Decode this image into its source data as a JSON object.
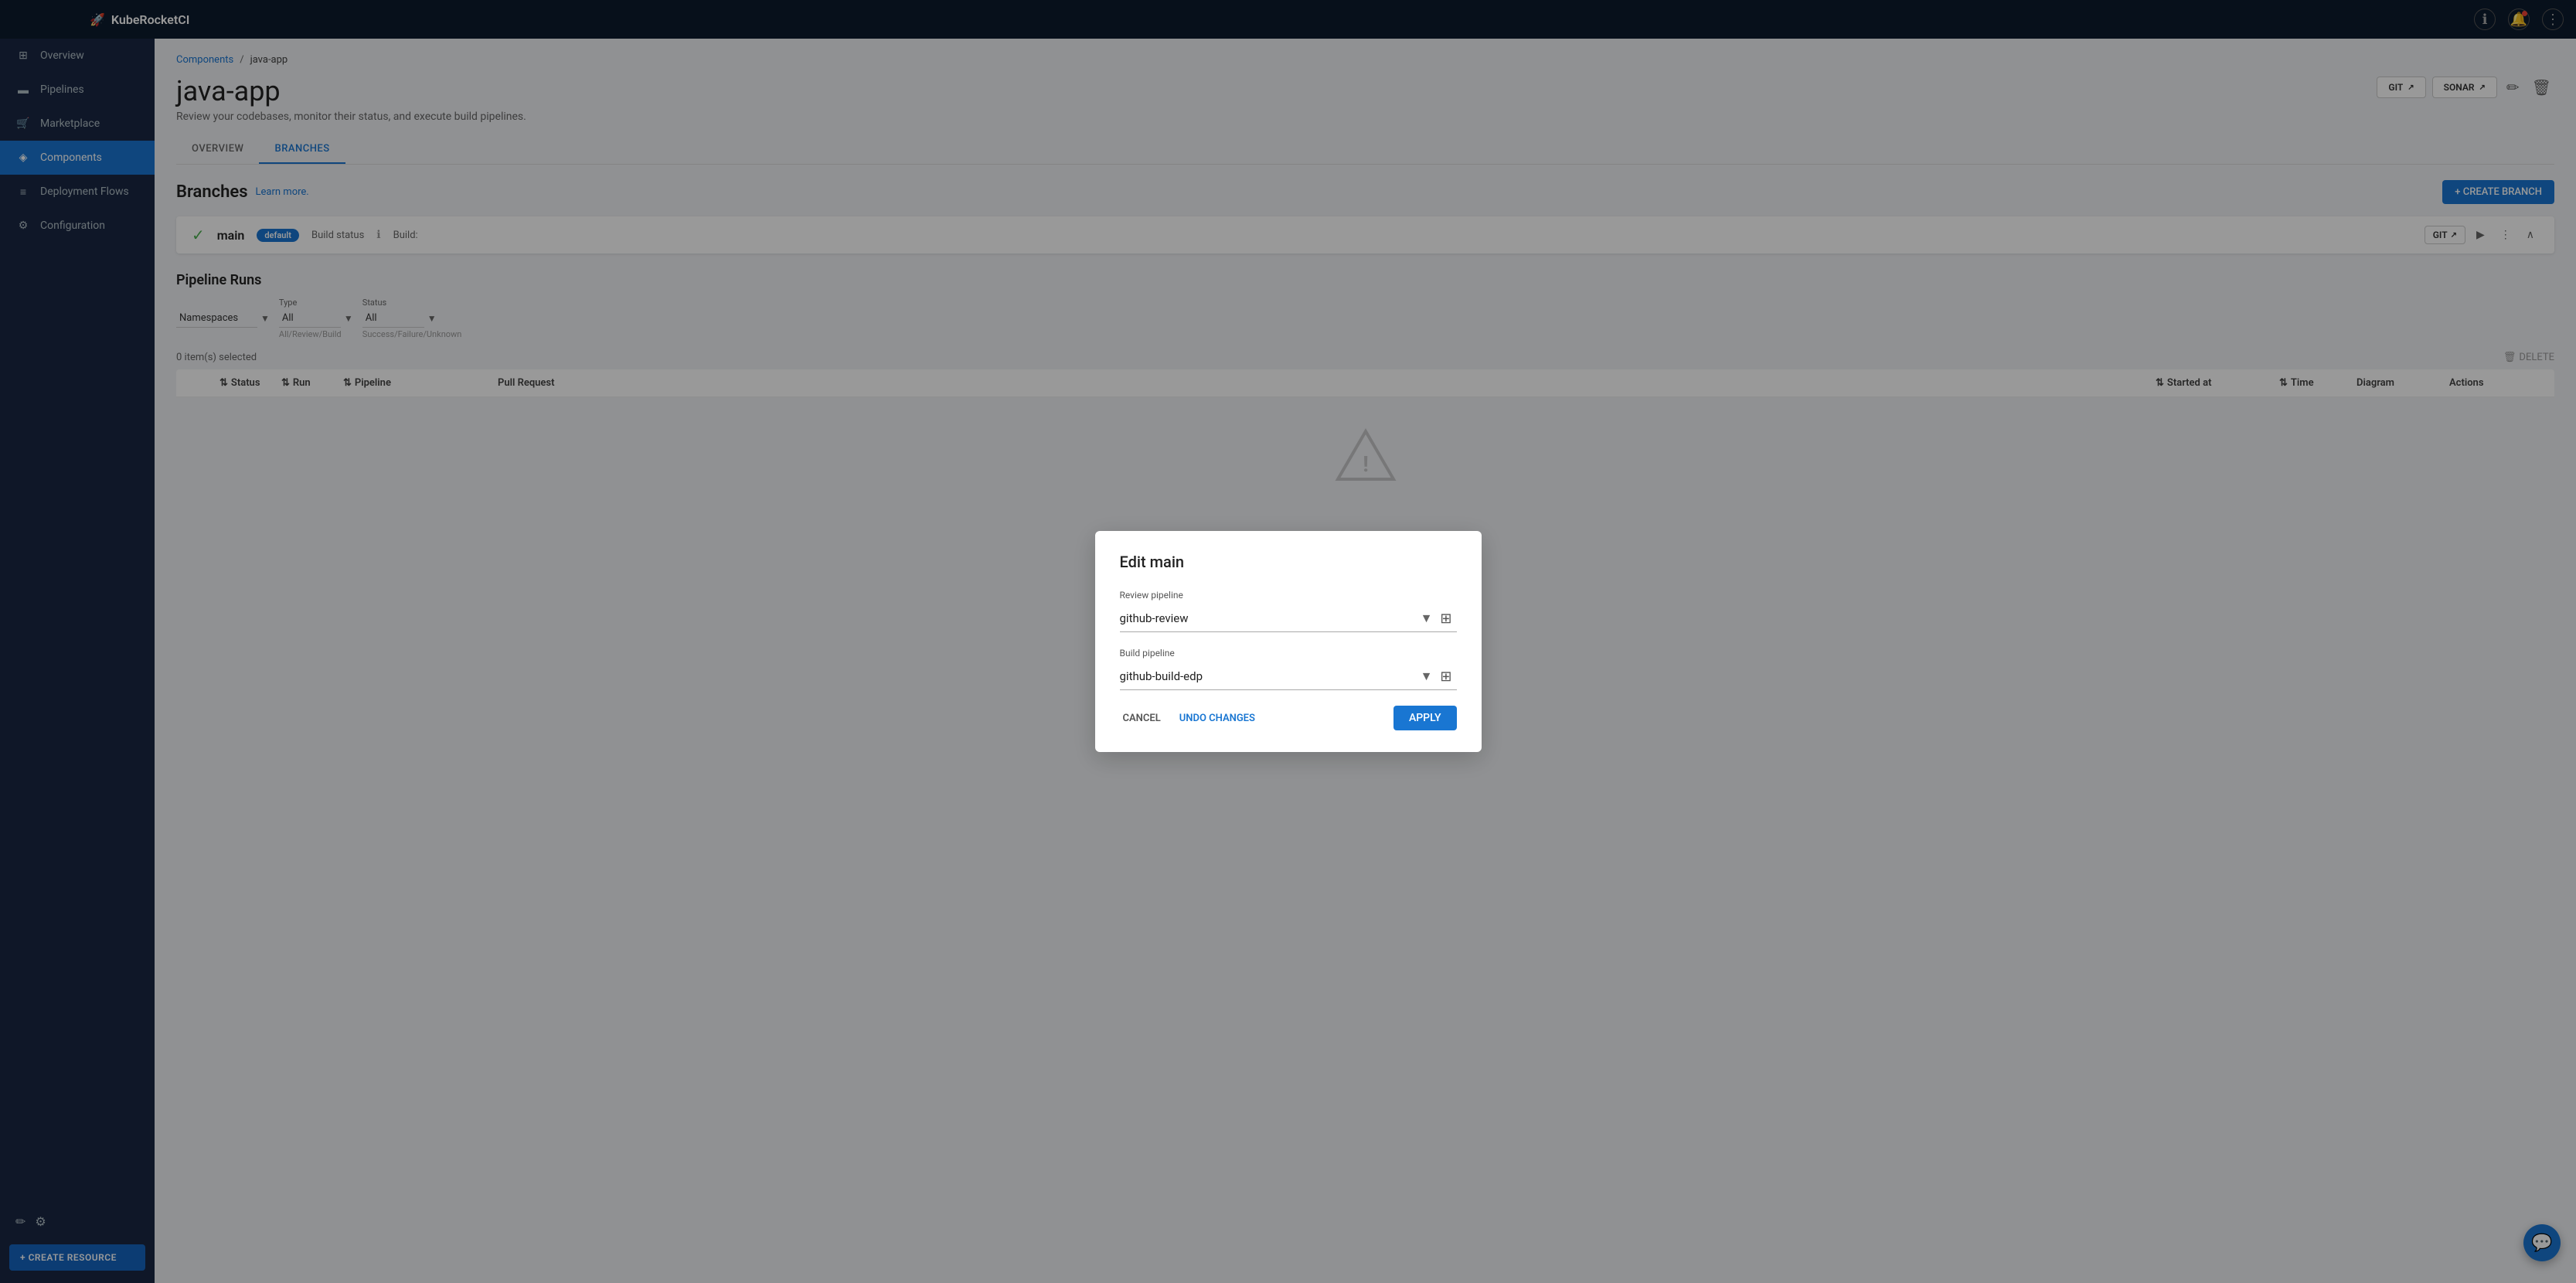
{
  "topbar": {
    "app_name": "KubeRocketCI",
    "logo": "🚀"
  },
  "sidebar": {
    "items": [
      {
        "id": "overview",
        "label": "Overview",
        "icon": "⊞"
      },
      {
        "id": "pipelines",
        "label": "Pipelines",
        "icon": "▬"
      },
      {
        "id": "marketplace",
        "label": "Marketplace",
        "icon": "🛒"
      },
      {
        "id": "components",
        "label": "Components",
        "icon": "◈",
        "active": true
      },
      {
        "id": "deployment-flows",
        "label": "Deployment Flows",
        "icon": "≡"
      },
      {
        "id": "configuration",
        "label": "Configuration",
        "icon": "⚙"
      }
    ],
    "create_resource_label": "+ CREATE RESOURCE"
  },
  "breadcrumb": {
    "parent": "Components",
    "separator": "/",
    "current": "java-app"
  },
  "page": {
    "title": "java-app",
    "subtitle": "Review your codebases, monitor their status, and execute build pipelines.",
    "git_label": "GIT",
    "sonar_label": "SONAR"
  },
  "tabs": [
    {
      "id": "overview",
      "label": "OVERVIEW"
    },
    {
      "id": "branches",
      "label": "BRANCHES",
      "active": true
    }
  ],
  "branches": {
    "title": "Branches",
    "learn_more": "Learn more.",
    "create_branch_label": "+ CREATE BRANCH",
    "items": [
      {
        "name": "main",
        "badge": "default",
        "build_status_label": "Build status",
        "build_label": "Build:"
      }
    ]
  },
  "pipeline_runs": {
    "title": "Pipeline Runs",
    "namespaces_label": "Namespaces",
    "type_label": "Type",
    "type_value": "All",
    "type_hint": "All/Review/Build",
    "status_label": "Status",
    "status_value": "All",
    "status_hint": "Success/Failure/Unknown",
    "selected_count": "0 item(s) selected",
    "delete_label": "DELETE",
    "columns": {
      "status": "Status",
      "run": "Run",
      "pipeline": "Pipeline",
      "pull_request": "Pull Request",
      "started_at": "Started at",
      "time": "Time",
      "diagram": "Diagram",
      "actions": "Actions"
    }
  },
  "modal": {
    "title": "Edit main",
    "review_pipeline_label": "Review pipeline",
    "review_pipeline_value": "github-review",
    "build_pipeline_label": "Build pipeline",
    "build_pipeline_value": "github-build-edp",
    "cancel_label": "CANCEL",
    "undo_label": "UNDO CHANGES",
    "apply_label": "APPLY"
  }
}
